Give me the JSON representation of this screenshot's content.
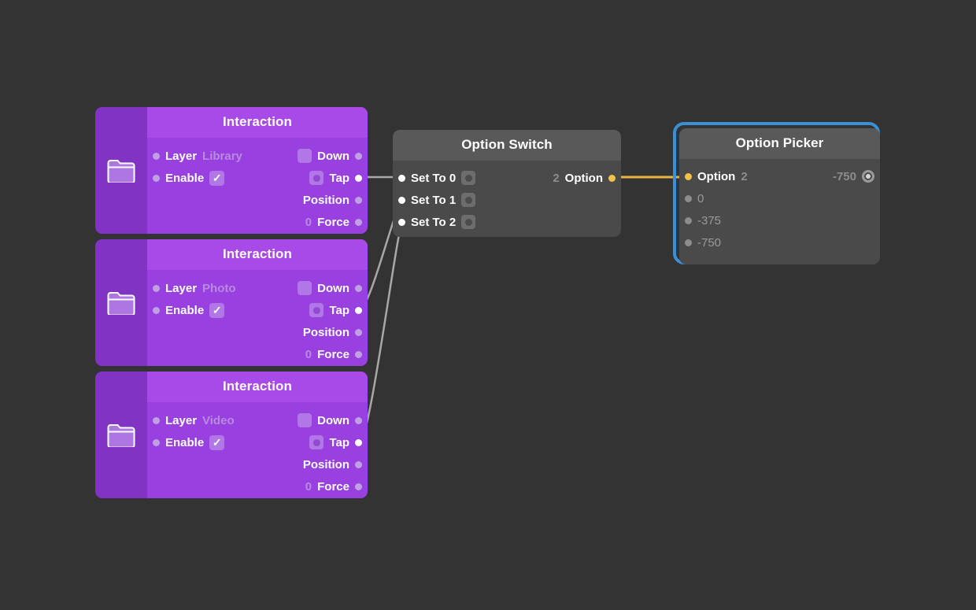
{
  "canvas": {
    "background": "#333333",
    "selection_color": "#3b8fd4"
  },
  "nodes": [
    {
      "id": "interaction-library",
      "title": "Interaction",
      "type": "interaction",
      "icon": "folder-icon",
      "inputs": [
        {
          "label": "Layer",
          "value": "Library",
          "port": "dim"
        },
        {
          "label": "Enable",
          "value": "✓",
          "control": "checkbox",
          "port": "dim"
        }
      ],
      "outputs": [
        {
          "label": "Down",
          "control": "bool-square",
          "port": "dim"
        },
        {
          "label": "Tap",
          "control": "pulse-square",
          "port": "connected"
        },
        {
          "label": "Position",
          "port": "dim"
        },
        {
          "label": "Force",
          "value": "0",
          "port": "dim"
        }
      ]
    },
    {
      "id": "interaction-photo",
      "title": "Interaction",
      "type": "interaction",
      "icon": "folder-icon",
      "inputs": [
        {
          "label": "Layer",
          "value": "Photo",
          "port": "dim"
        },
        {
          "label": "Enable",
          "value": "✓",
          "control": "checkbox",
          "port": "dim"
        }
      ],
      "outputs": [
        {
          "label": "Down",
          "control": "bool-square",
          "port": "dim"
        },
        {
          "label": "Tap",
          "control": "pulse-square",
          "port": "connected"
        },
        {
          "label": "Position",
          "port": "dim"
        },
        {
          "label": "Force",
          "value": "0",
          "port": "dim"
        }
      ]
    },
    {
      "id": "interaction-video",
      "title": "Interaction",
      "type": "interaction",
      "icon": "folder-icon",
      "inputs": [
        {
          "label": "Layer",
          "value": "Video",
          "port": "dim"
        },
        {
          "label": "Enable",
          "value": "✓",
          "control": "checkbox",
          "port": "dim"
        }
      ],
      "outputs": [
        {
          "label": "Down",
          "control": "bool-square",
          "port": "dim"
        },
        {
          "label": "Tap",
          "control": "pulse-square",
          "port": "connected"
        },
        {
          "label": "Position",
          "port": "dim"
        },
        {
          "label": "Force",
          "value": "0",
          "port": "dim"
        }
      ]
    }
  ],
  "option_switch": {
    "title": "Option Switch",
    "inputs": [
      {
        "label": "Set To 0",
        "control": "pulse-square",
        "port": "connected"
      },
      {
        "label": "Set To 1",
        "control": "pulse-square",
        "port": "connected"
      },
      {
        "label": "Set To 2",
        "control": "pulse-square",
        "port": "connected"
      }
    ],
    "outputs": [
      {
        "label": "Option",
        "value": "2",
        "port": "gold"
      }
    ]
  },
  "option_picker": {
    "title": "Option Picker",
    "selected": true,
    "input": {
      "label": "Option",
      "value": "2",
      "port": "gold"
    },
    "output": {
      "value": "-750",
      "port": "donut"
    },
    "options": [
      {
        "label": "0",
        "port": "dim"
      },
      {
        "label": "-375",
        "port": "dim"
      },
      {
        "label": "-750",
        "port": "dim"
      }
    ]
  },
  "wires": [
    {
      "from": "interaction-library.Tap",
      "to": "option_switch.Set To 0",
      "color": "#a8a8a8"
    },
    {
      "from": "interaction-photo.Tap",
      "to": "option_switch.Set To 1",
      "color": "#a8a8a8"
    },
    {
      "from": "interaction-video.Tap",
      "to": "option_switch.Set To 2",
      "color": "#a8a8a8"
    },
    {
      "from": "option_switch.Option",
      "to": "option_picker.Option",
      "color": "#e8b43c"
    }
  ]
}
